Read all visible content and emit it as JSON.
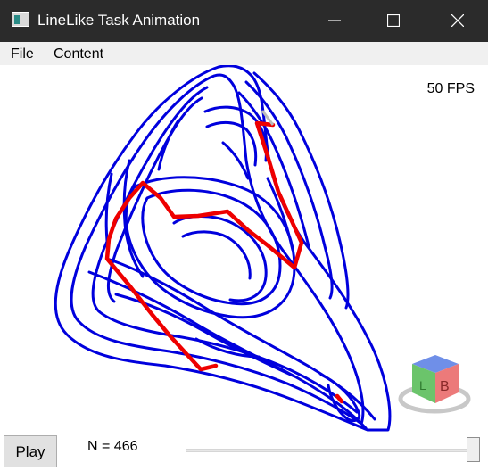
{
  "window": {
    "title": "LineLike Task Animation"
  },
  "menu": {
    "items": [
      "File",
      "Content"
    ]
  },
  "canvas": {
    "fps_label": "50 FPS",
    "curve_color": "#0000dd",
    "trace_color": "#ee0000"
  },
  "controls": {
    "play_label": "Play",
    "n_label": "N = 466",
    "slider_value": 1.0
  },
  "cube_letters": [
    "L",
    "B"
  ]
}
